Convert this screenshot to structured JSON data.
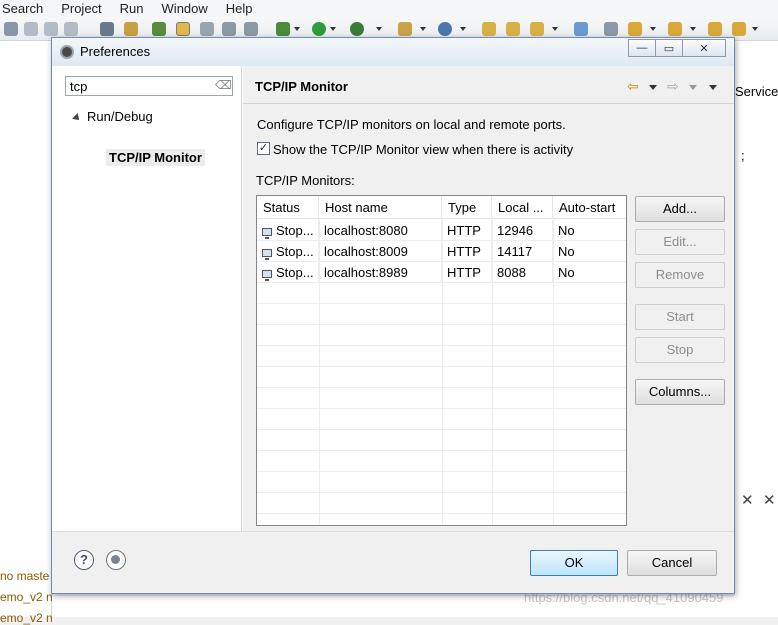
{
  "ide": {
    "menu": [
      "Search",
      "Project",
      "Run",
      "Window",
      "Help"
    ],
    "left_tree": [
      "no maste",
      "emo_v2 n",
      "emo_v2 n"
    ],
    "right_text": "Service.",
    "right_semicolon": ";"
  },
  "watermark": "https://blog.csdn.net/qq_41090459",
  "dialog": {
    "title": "Preferences",
    "filter_value": "tcp",
    "tree": {
      "parent": "Run/Debug",
      "selected": "TCP/IP Monitor"
    },
    "page": {
      "title": "TCP/IP Monitor",
      "description": "Configure TCP/IP monitors on local and remote ports.",
      "show_view_label": "Show the TCP/IP Monitor view when there is activity",
      "show_view_checked": true,
      "monitors_label": "TCP/IP Monitors:",
      "columns": [
        "Status",
        "Host name",
        "Type",
        "Local ...",
        "Auto-start"
      ],
      "rows": [
        {
          "status": "Stop...",
          "host": "localhost:8080",
          "type": "HTTP",
          "local": "12946",
          "auto": "No"
        },
        {
          "status": "Stop...",
          "host": "localhost:8009",
          "type": "HTTP",
          "local": "14117",
          "auto": "No"
        },
        {
          "status": "Stop...",
          "host": "localhost:8989",
          "type": "HTTP",
          "local": "8088",
          "auto": "No"
        }
      ],
      "buttons": {
        "add": "Add...",
        "edit": "Edit...",
        "remove": "Remove",
        "start": "Start",
        "stop": "Stop",
        "columns": "Columns..."
      }
    },
    "footer": {
      "ok": "OK",
      "cancel": "Cancel"
    }
  }
}
